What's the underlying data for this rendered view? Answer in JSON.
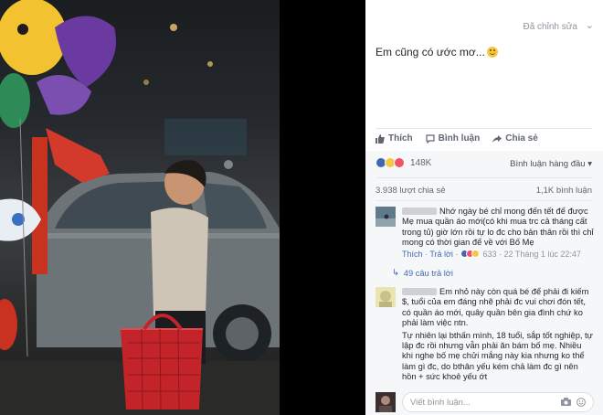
{
  "post": {
    "edited_label": "Đã chỉnh sửa",
    "text": "Em cũng có ước mơ...",
    "emoji": "smile-emoji"
  },
  "actions": {
    "like": "Thích",
    "comment": "Bình luận",
    "share": "Chia sẻ"
  },
  "stats": {
    "reactions_count": "148K",
    "sort_label": "Bình luận hàng đầu",
    "shares": "3.938 lượt chia sẻ",
    "comments": "1,1K bình luận"
  },
  "comments": [
    {
      "text": "Nhớ ngày bé chỉ mong đến tết để được Mẹ mua quần áo mới(có khi mua trc cả tháng cất trong tủ) giờ lớn rồi tự lo đc cho bản thân rồi thì chỉ mong có thời gian để về với Bố Mẹ",
      "like": "Thích",
      "reply": "Trả lời",
      "reactions": "633",
      "time": "22 Tháng 1 lúc 22:47",
      "replies_label": "49 câu trả lời"
    },
    {
      "text": "Em nhỏ này còn quá bé để phải đi kiếm $, tuổi của em đáng nhẽ phải đc vui chơi đón tết, có quần áo mới, quây quần bên gia đình chứ ko phải làm việc ntn.",
      "text2": "Tự nhiên lại bthấn mình, 18 tuổi, sắp tốt nghiệp, tự lập đc rồi nhưng vẫn phải ăn bám bố mẹ. Nhiều khi nghe bố mẹ chửi mắng này kia nhưng ko thể làm gì đc, do bthân yếu kém chả làm đc gì nên hồn + sức khoẻ yếu ớt"
    }
  ],
  "composer": {
    "placeholder": "Viết bình luận..."
  },
  "colors": {
    "fb_blue": "#4267b2",
    "text": "#1d2129",
    "muted": "#90949c"
  }
}
